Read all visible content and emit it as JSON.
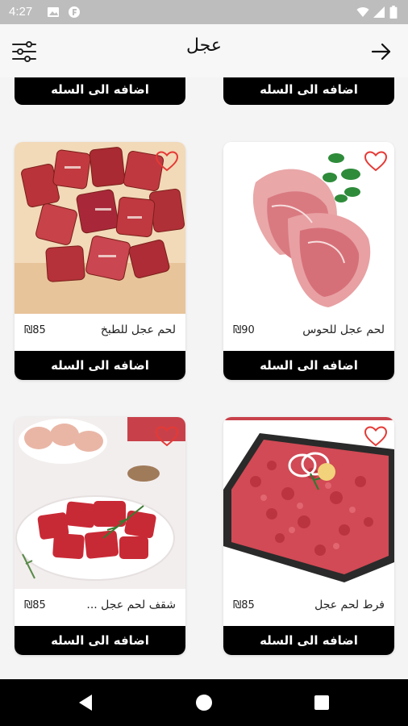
{
  "status_bar": {
    "time": "4:27"
  },
  "header": {
    "title": "عجل"
  },
  "add_to_cart_label": "اضافه الى السله",
  "top_row": [
    {
      "button": "اضافه الى السله"
    },
    {
      "button": "اضافه الى السله"
    }
  ],
  "products": [
    {
      "name": "لحم عجل للطبخ",
      "price": "₪85",
      "button": "اضافه الى السله"
    },
    {
      "name": "لحم عجل للحوس",
      "price": "₪90",
      "button": "اضافه الى السله"
    },
    {
      "name": "شقف لحم عجل ...",
      "price": "₪85",
      "button": "اضافه الى السله"
    },
    {
      "name": "فرط لحم عجل",
      "price": "₪85",
      "button": "اضافه الى السله"
    }
  ],
  "colors": {
    "button_bg": "#000000",
    "heart": "#e53935",
    "status_bar": "#bdbdbd"
  }
}
